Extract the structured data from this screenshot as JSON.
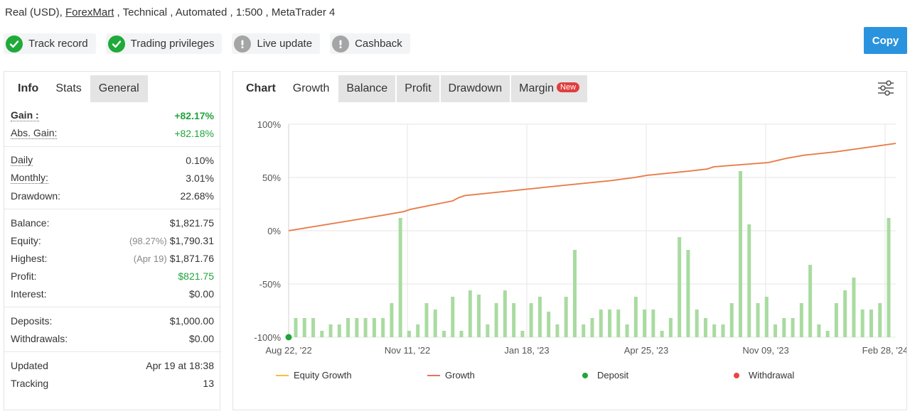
{
  "header": {
    "prefix": "Real (USD), ",
    "broker": "ForexMart",
    "suffix": " , Technical , Automated , 1:500 , MetaTrader 4"
  },
  "badges": [
    {
      "label": "Track record",
      "status": "ok"
    },
    {
      "label": "Trading privileges",
      "status": "ok"
    },
    {
      "label": "Live update",
      "status": "warn"
    },
    {
      "label": "Cashback",
      "status": "warn"
    }
  ],
  "copy_label": "Copy",
  "left_tabs": [
    "Info",
    "Stats",
    "General"
  ],
  "stats": {
    "gain": {
      "label": "Gain :",
      "value": "+82.17%"
    },
    "abs_gain": {
      "label": "Abs. Gain:",
      "value": "+82.18%"
    },
    "daily": {
      "label": "Daily",
      "value": "0.10%"
    },
    "monthly": {
      "label": "Monthly:",
      "value": "3.01%"
    },
    "drawdown": {
      "label": "Drawdown:",
      "value": "22.68%"
    },
    "balance": {
      "label": "Balance:",
      "value": "$1,821.75"
    },
    "equity": {
      "label": "Equity:",
      "pre": "(98.27%)",
      "value": "$1,790.31"
    },
    "highest": {
      "label": "Highest:",
      "pre": "(Apr 19)",
      "value": "$1,871.76"
    },
    "profit": {
      "label": "Profit:",
      "value": "$821.75"
    },
    "interest": {
      "label": "Interest:",
      "value": "$0.00"
    },
    "deposits": {
      "label": "Deposits:",
      "value": "$1,000.00"
    },
    "withdrawals": {
      "label": "Withdrawals:",
      "value": "$0.00"
    },
    "updated": {
      "label": "Updated",
      "value": "Apr 19 at 18:38"
    },
    "tracking": {
      "label": "Tracking",
      "value": "13"
    }
  },
  "chart_tabs": [
    "Chart",
    "Growth",
    "Balance",
    "Profit",
    "Drawdown",
    "Margin"
  ],
  "new_badge": "New",
  "chart_data": {
    "type": "line",
    "y_ticks": [
      "100%",
      "50%",
      "0%",
      "-50%",
      "-100%"
    ],
    "ylim": [
      -100,
      100
    ],
    "x_ticks": [
      "Aug 22, '22",
      "Nov 11, '22",
      "Jan 18, '23",
      "Apr 25, '23",
      "Nov 09, '23",
      "Feb 28, '24"
    ],
    "grid": true,
    "legend_position": "bottom",
    "colors": {
      "equity": "#f2c043",
      "growth": "#e8735d",
      "bars": "#a9dba0",
      "deposit": "#1fa53a",
      "withdrawal": "#e84545",
      "grid": "#e6e6e6"
    },
    "series": [
      {
        "name": "Equity Growth",
        "x": [
          0,
          15,
          19,
          20,
          27,
          28,
          29,
          46,
          53,
          57,
          59,
          66,
          69,
          70,
          79,
          82,
          85,
          90,
          100
        ],
        "y": [
          0,
          14,
          18,
          20,
          28,
          31,
          33,
          43,
          47,
          50,
          52,
          56,
          58,
          60,
          64,
          68,
          71,
          74,
          82
        ]
      },
      {
        "name": "Growth",
        "x": [
          0,
          15,
          19,
          20,
          27,
          28,
          29,
          46,
          53,
          57,
          59,
          66,
          69,
          70,
          79,
          82,
          85,
          90,
          100
        ],
        "y": [
          0,
          14,
          18,
          20,
          28,
          31,
          33,
          43,
          47,
          50,
          52,
          56,
          58,
          60,
          64,
          68,
          71,
          74,
          82
        ]
      }
    ],
    "bars": [
      -82,
      -82,
      -82,
      -94,
      -88,
      -88,
      -82,
      -82,
      -82,
      -82,
      -82,
      -68,
      12,
      -94,
      -88,
      -68,
      -74,
      -94,
      -62,
      -94,
      -56,
      -60,
      -88,
      -68,
      -56,
      -68,
      -94,
      -68,
      -62,
      -76,
      -88,
      -62,
      -18,
      -88,
      -82,
      -74,
      -74,
      -74,
      -88,
      -62,
      -74,
      -74,
      -94,
      -82,
      -6,
      -18,
      -74,
      -82,
      -88,
      -88,
      -68,
      56,
      6,
      -68,
      -62,
      -88,
      -82,
      -82,
      -68,
      -32,
      -88,
      -94,
      -68,
      -56,
      -44,
      -74,
      -74,
      -68,
      12
    ],
    "deposits": [
      {
        "x": 0,
        "y": -100
      }
    ],
    "legend": [
      {
        "label": "Equity Growth",
        "kind": "line",
        "color": "#f2c043"
      },
      {
        "label": "Growth",
        "kind": "line",
        "color": "#e8735d"
      },
      {
        "label": "Deposit",
        "kind": "dot",
        "color": "#1fa53a"
      },
      {
        "label": "Withdrawal",
        "kind": "dot",
        "color": "#e84545"
      }
    ]
  }
}
